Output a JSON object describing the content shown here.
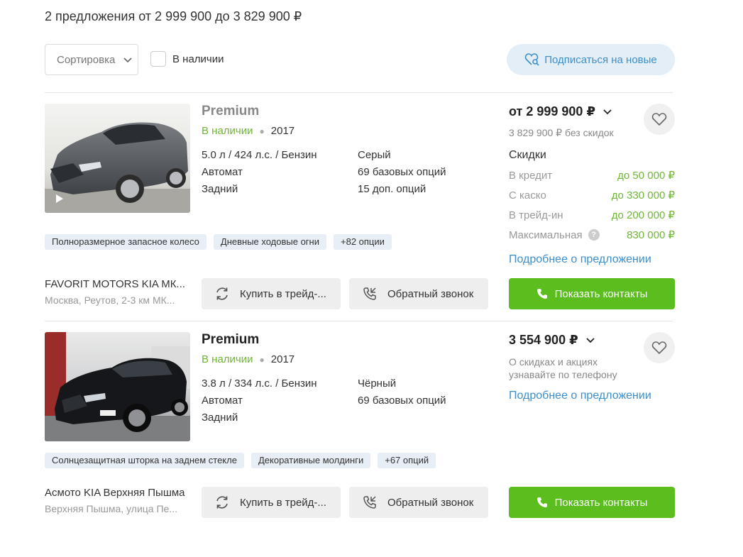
{
  "header": {
    "title": "2 предложения от 2 999 900 до 3 829 900 ₽"
  },
  "controls": {
    "sort_label": "Сортировка",
    "in_stock_label": "В наличии",
    "subscribe_label": "Подписаться на новые"
  },
  "colors": {
    "green": "#6fb536",
    "button_green": "#5bbd1e",
    "link_blue": "#3d8fcc",
    "tag_bg": "#e7eef5"
  },
  "offers": [
    {
      "title": "Premium",
      "availability": "В наличии",
      "year": "2017",
      "specs_left": [
        "5.0 л / 424 л.с. / Бензин",
        "Автомат",
        "Задний"
      ],
      "specs_right": [
        "Серый",
        "69 базовых опций",
        "15 доп. опций"
      ],
      "tags": [
        "Полноразмерное запасное колесо",
        "Дневные ходовые огни",
        "+82 опции"
      ],
      "price": "от 2 999 900 ₽",
      "price_no_discount": "3 829 900 ₽ без скидок",
      "discounts_title": "Скидки",
      "discounts": [
        {
          "label": "В кредит",
          "value": "до 50 000 ₽"
        },
        {
          "label": "С каско",
          "value": "до 330 000 ₽"
        },
        {
          "label": "В трейд-ин",
          "value": "до 200 000 ₽"
        },
        {
          "label": "Максимальная",
          "value": "830 000 ₽"
        }
      ],
      "details_link": "Подробнее о предложении",
      "dealer_name": "FAVORIT MOTORS KIA МК...",
      "dealer_address": "Москва, Реутов, 2-3 км МК...",
      "tradein_label": "Купить в трейд-...",
      "callback_label": "Обратный звонок",
      "contacts_label": "Показать контакты",
      "has_video": true
    },
    {
      "title": "Premium",
      "availability": "В наличии",
      "year": "2017",
      "specs_left": [
        "3.8 л / 334 л.с. / Бензин",
        "Автомат",
        "Задний"
      ],
      "specs_right": [
        "Чёрный",
        "69 базовых опций"
      ],
      "tags": [
        "Солнцезащитная шторка на заднем стекле",
        "Декоративные молдинги",
        "+67 опций"
      ],
      "price": "3 554 900 ₽",
      "price_info": [
        "О скидках и акциях",
        "узнавайте по телефону"
      ],
      "details_link": "Подробнее о предложении",
      "dealer_name": "Асмото KIA Верхняя Пышма",
      "dealer_address": "Верхняя Пышма, улица Пе...",
      "tradein_label": "Купить в трейд-...",
      "callback_label": "Обратный звонок",
      "contacts_label": "Показать контакты"
    }
  ]
}
